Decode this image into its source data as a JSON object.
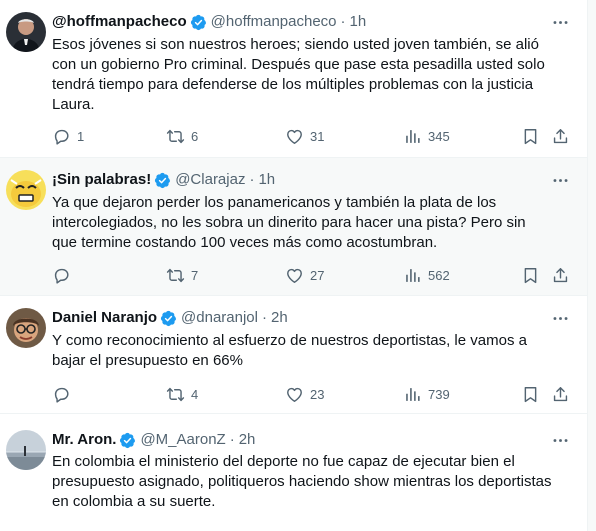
{
  "tweets": [
    {
      "name": "@hoffmanpacheco",
      "handle": "@hoffmanpacheco",
      "separator": "·",
      "time": "1h",
      "text": "Esos jóvenes si son nuestros heroes; siendo usted joven también, se alió con un gobierno Pro criminal. Después que pase esta pesadilla usted solo tendrá tiempo para defenderse de los múltiples problemas con la justicia Laura.",
      "replies": "1",
      "reposts": "6",
      "likes": "31",
      "views": "345",
      "avatar_icon": "person-photo"
    },
    {
      "name": "¡Sin palabras!",
      "handle": "@Clarajaz",
      "separator": "·",
      "time": "1h",
      "text": "Ya que dejaron perder los panamericanos y también la plata de los intercolegiados, no les sobra un dinerito para hacer una pista? Pero sin que termine costando 100 veces más como acostumbran.",
      "replies": "",
      "reposts": "7",
      "likes": "27",
      "views": "562",
      "avatar_icon": "cartoon-face"
    },
    {
      "name": "Daniel Naranjo",
      "handle": "@dnaranjol",
      "separator": "·",
      "time": "2h",
      "text": "Y como reconocimiento al esfuerzo de nuestros deportistas, le vamos a bajar el presupuesto en 66%",
      "replies": "",
      "reposts": "4",
      "likes": "23",
      "views": "739",
      "avatar_icon": "person-glasses"
    },
    {
      "name": "Mr. Aron.",
      "handle": "@M_AaronZ",
      "separator": "·",
      "time": "2h",
      "text": "En colombia el ministerio del deporte no fue capaz de ejecutar bien el presupuesto asignado, politiqueros haciendo show mientras los deportistas en colombia a su suerte.",
      "avatar_icon": "landscape-photo"
    }
  ],
  "colors": {
    "verified": "#1d9bf0",
    "muted": "#536471",
    "text": "#0f1419",
    "highlight_bg": "#f7f9f9"
  }
}
